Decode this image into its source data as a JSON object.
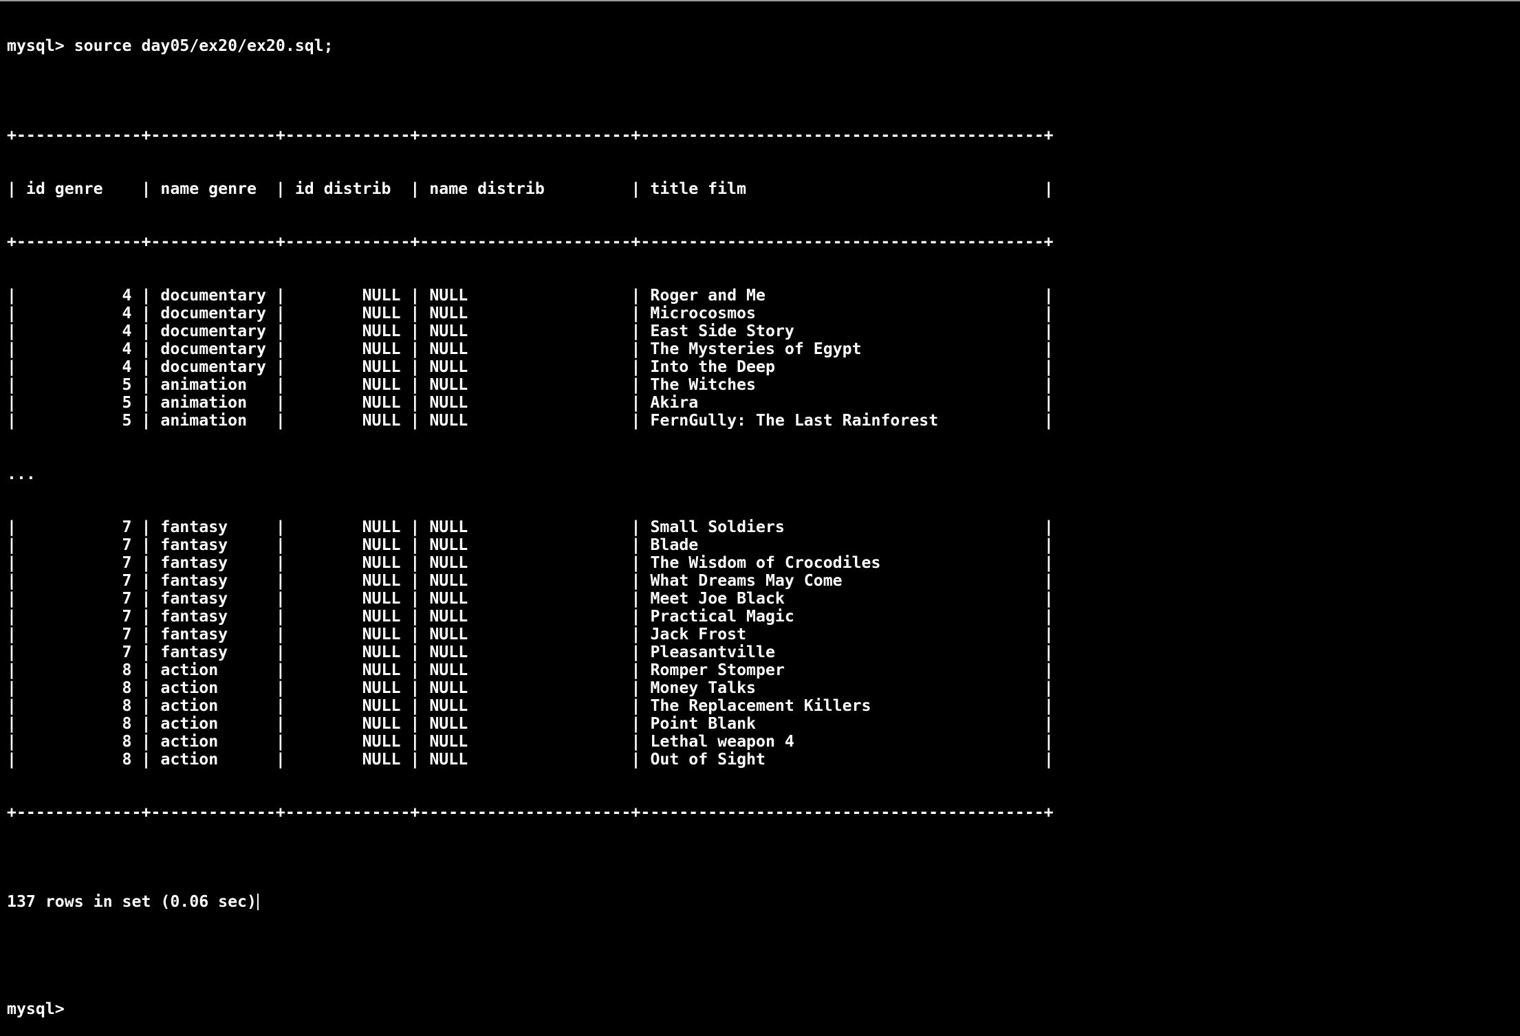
{
  "terminal": {
    "command_line": "mysql> source day05/ex20/ex20.sql;",
    "table_border": "+-------------+-------------+-------------+----------------------+------------------------------------------+",
    "header": [
      {
        "text": "id genre",
        "align": "left",
        "width": 11
      },
      {
        "text": "name genre",
        "align": "left",
        "width": 11
      },
      {
        "text": "id distrib",
        "align": "left",
        "width": 11
      },
      {
        "text": "name distrib",
        "align": "left",
        "width": 20
      },
      {
        "text": "title film",
        "align": "left",
        "width": 40
      }
    ],
    "col_widths": [
      11,
      11,
      11,
      20,
      40
    ],
    "rows_before_ellipsis": [
      [
        "4",
        "documentary",
        "NULL",
        "NULL",
        "Roger and Me"
      ],
      [
        "4",
        "documentary",
        "NULL",
        "NULL",
        "Microcosmos"
      ],
      [
        "4",
        "documentary",
        "NULL",
        "NULL",
        "East Side Story"
      ],
      [
        "4",
        "documentary",
        "NULL",
        "NULL",
        "The Mysteries of Egypt"
      ],
      [
        "4",
        "documentary",
        "NULL",
        "NULL",
        "Into the Deep"
      ],
      [
        "5",
        "animation",
        "NULL",
        "NULL",
        "The Witches"
      ],
      [
        "5",
        "animation",
        "NULL",
        "NULL",
        "Akira"
      ],
      [
        "5",
        "animation",
        "NULL",
        "NULL",
        "FernGully: The Last Rainforest"
      ]
    ],
    "ellipsis": "...",
    "rows_after_ellipsis": [
      [
        "7",
        "fantasy",
        "NULL",
        "NULL",
        "Small Soldiers"
      ],
      [
        "7",
        "fantasy",
        "NULL",
        "NULL",
        "Blade"
      ],
      [
        "7",
        "fantasy",
        "NULL",
        "NULL",
        "The Wisdom of Crocodiles"
      ],
      [
        "7",
        "fantasy",
        "NULL",
        "NULL",
        "What Dreams May Come"
      ],
      [
        "7",
        "fantasy",
        "NULL",
        "NULL",
        "Meet Joe Black"
      ],
      [
        "7",
        "fantasy",
        "NULL",
        "NULL",
        "Practical Magic"
      ],
      [
        "7",
        "fantasy",
        "NULL",
        "NULL",
        "Jack Frost"
      ],
      [
        "7",
        "fantasy",
        "NULL",
        "NULL",
        "Pleasantville"
      ],
      [
        "8",
        "action",
        "NULL",
        "NULL",
        "Romper Stomper"
      ],
      [
        "8",
        "action",
        "NULL",
        "NULL",
        "Money Talks"
      ],
      [
        "8",
        "action",
        "NULL",
        "NULL",
        "The Replacement Killers"
      ],
      [
        "8",
        "action",
        "NULL",
        "NULL",
        "Point Blank"
      ],
      [
        "8",
        "action",
        "NULL",
        "NULL",
        "Lethal weapon 4"
      ],
      [
        "8",
        "action",
        "NULL",
        "NULL",
        "Out of Sight"
      ]
    ],
    "column_alignment": [
      "right",
      "left",
      "right",
      "left",
      "left"
    ],
    "status_line": "137 rows in set (0.06 sec)",
    "prompt": "mysql>",
    "colors": {
      "background": "#000000",
      "foreground": "#ffffff"
    }
  }
}
